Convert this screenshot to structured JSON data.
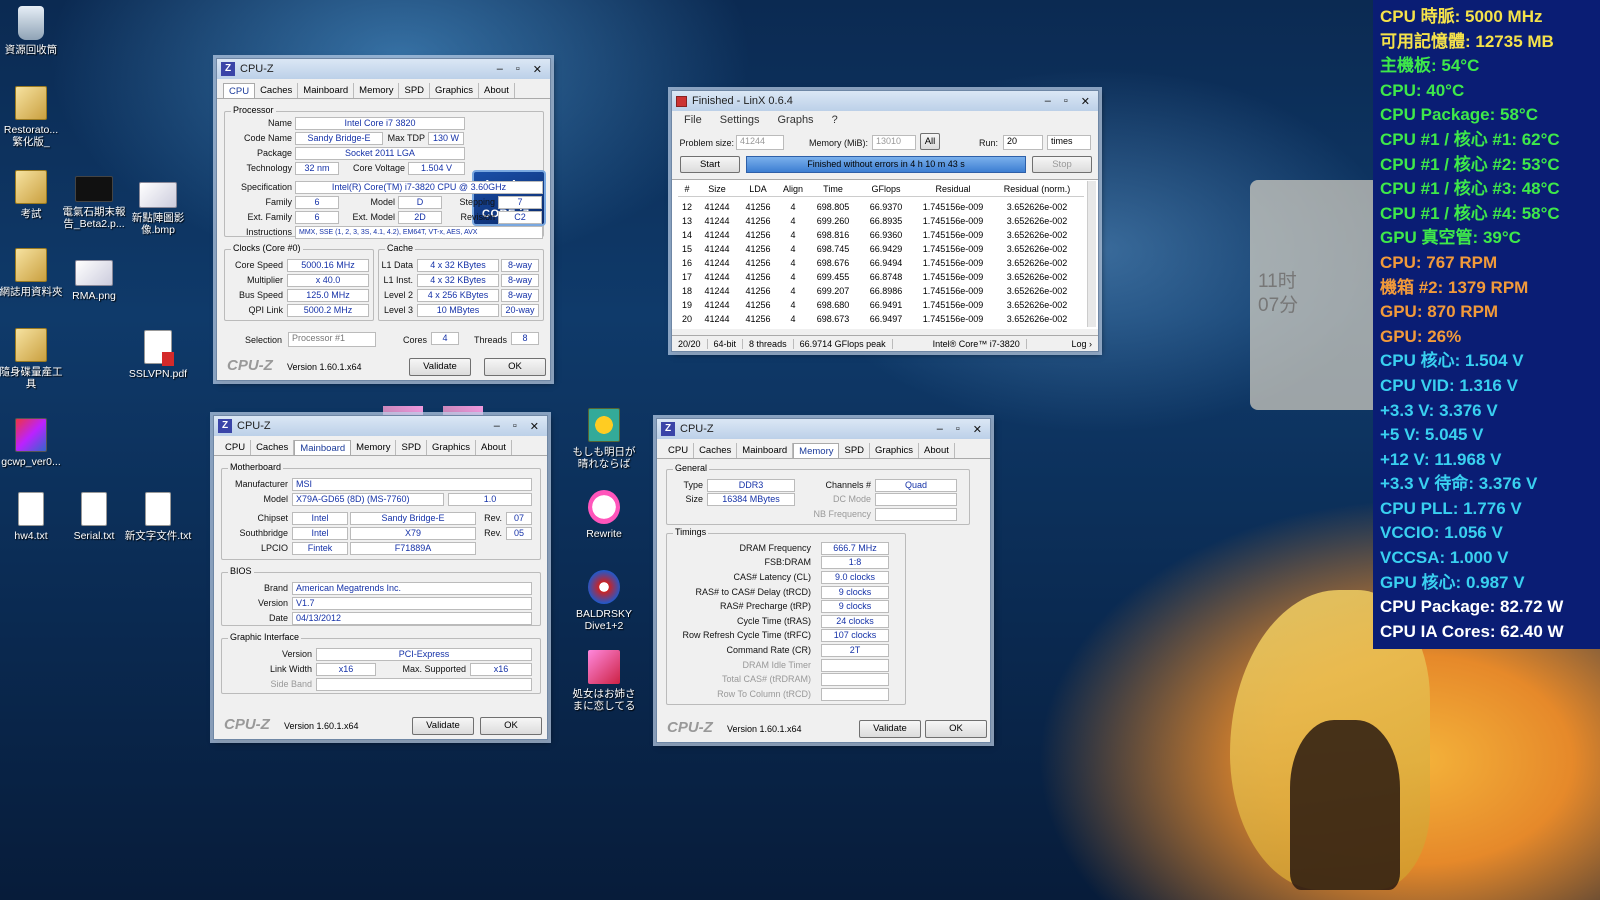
{
  "desktop_icons": [
    {
      "label": "資源回收筒",
      "icon": "recycle-bin-icon"
    },
    {
      "label": "Restorato...\n繁化版_",
      "icon": "folder-icon"
    },
    {
      "label": "考試",
      "icon": "folder-icon"
    },
    {
      "label": "網誌用資料夾",
      "icon": "folder-icon"
    },
    {
      "label": "隨身碟量產工具",
      "icon": "folder-icon"
    },
    {
      "label": "gcwp_ver0...",
      "icon": "app-icon"
    },
    {
      "label": "hw4.txt",
      "icon": "text-file-icon"
    },
    {
      "label": "電氣石期末報告_Beta2.p...",
      "icon": "pptx-icon"
    },
    {
      "label": "RMA.png",
      "icon": "image-icon"
    },
    {
      "label": "Serial.txt",
      "icon": "text-file-icon"
    },
    {
      "label": "新點陣圖影像.bmp",
      "icon": "image-icon"
    },
    {
      "label": "SSLVPN.pdf",
      "icon": "pdf-icon"
    },
    {
      "label": "新文字文件.txt",
      "icon": "text-file-icon"
    },
    {
      "label": "もしも明日が晴れならば",
      "icon": "sunflower-icon"
    },
    {
      "label": "Rewrite",
      "icon": "rewrite-icon"
    },
    {
      "label": "BALDRSKY Dive1+2",
      "icon": "baldrsky-icon"
    },
    {
      "label": "処女はお姉さまに恋してる",
      "icon": "ribbon-icon"
    }
  ],
  "clock_widget": {
    "hour": "11时",
    "minute": "07分"
  },
  "cpuz_cpu": {
    "title": "CPU-Z",
    "tabs": [
      "CPU",
      "Caches",
      "Mainboard",
      "Memory",
      "SPD",
      "Graphics",
      "About"
    ],
    "active_tab": "CPU",
    "processor_group": "Processor",
    "name_label": "Name",
    "name": "Intel Core i7 3820",
    "codename_label": "Code Name",
    "codename": "Sandy Bridge-E",
    "tdp_label": "Max TDP",
    "tdp": "130 W",
    "package_label": "Package",
    "package": "Socket 2011 LGA",
    "technology_label": "Technology",
    "technology": "32 nm",
    "core_voltage_label": "Core Voltage",
    "core_voltage": "1.504 V",
    "spec_label": "Specification",
    "spec": "Intel(R) Core(TM) i7-3820 CPU @ 3.60GHz",
    "family_label": "Family",
    "family": "6",
    "model_label": "Model",
    "model": "D",
    "stepping_label": "Stepping",
    "stepping": "7",
    "ext_family_label": "Ext. Family",
    "ext_family": "6",
    "ext_model_label": "Ext. Model",
    "ext_model": "2D",
    "revision_label": "Revision",
    "revision": "C2",
    "instructions_label": "Instructions",
    "instructions": "MMX, SSE (1, 2, 3, 3S, 4.1, 4.2), EM64T, VT-x, AES, AVX",
    "clocks_group": "Clocks (Core #0)",
    "core_speed_label": "Core Speed",
    "core_speed": "5000.16 MHz",
    "multiplier_label": "Multiplier",
    "multiplier": "x 40.0",
    "bus_speed_label": "Bus Speed",
    "bus_speed": "125.0 MHz",
    "qpi_label": "QPI Link",
    "qpi": "5000.2 MHz",
    "cache_group": "Cache",
    "l1d_label": "L1 Data",
    "l1d": "4 x 32 KBytes",
    "l1d_way": "8-way",
    "l1i_label": "L1 Inst.",
    "l1i": "4 x 32 KBytes",
    "l1i_way": "8-way",
    "l2_label": "Level 2",
    "l2": "4 x 256 KBytes",
    "l2_way": "8-way",
    "l3_label": "Level 3",
    "l3": "10 MBytes",
    "l3_way": "20-way",
    "selection_label": "Selection",
    "selection": "Processor #1",
    "cores_label": "Cores",
    "cores": "4",
    "threads_label": "Threads",
    "threads": "8",
    "logo": "CPU-Z",
    "version": "Version 1.60.1.x64",
    "validate": "Validate",
    "ok": "OK",
    "intel_logo": {
      "brand": "intel",
      "inside": "inside",
      "product": "CORE i7"
    }
  },
  "linx": {
    "title": "Finished - LinX 0.6.4",
    "menu": [
      "File",
      "Settings",
      "Graphs",
      "?"
    ],
    "problem_size_label": "Problem size:",
    "problem_size": "41244",
    "memory_label": "Memory (MiB):",
    "memory": "13010",
    "all_button": "All",
    "run_label": "Run:",
    "run": "20",
    "run_unit": "times",
    "start": "Start",
    "stop": "Stop",
    "status": "Finished without errors in 4 h 10 m 43 s",
    "columns": [
      "#",
      "Size",
      "LDA",
      "Align",
      "Time",
      "GFlops",
      "Residual",
      "Residual (norm.)"
    ],
    "rows": [
      [
        "12",
        "41244",
        "41256",
        "4",
        "698.805",
        "66.9370",
        "1.745156e-009",
        "3.652626e-002"
      ],
      [
        "13",
        "41244",
        "41256",
        "4",
        "699.260",
        "66.8935",
        "1.745156e-009",
        "3.652626e-002"
      ],
      [
        "14",
        "41244",
        "41256",
        "4",
        "698.816",
        "66.9360",
        "1.745156e-009",
        "3.652626e-002"
      ],
      [
        "15",
        "41244",
        "41256",
        "4",
        "698.745",
        "66.9429",
        "1.745156e-009",
        "3.652626e-002"
      ],
      [
        "16",
        "41244",
        "41256",
        "4",
        "698.676",
        "66.9494",
        "1.745156e-009",
        "3.652626e-002"
      ],
      [
        "17",
        "41244",
        "41256",
        "4",
        "699.455",
        "66.8748",
        "1.745156e-009",
        "3.652626e-002"
      ],
      [
        "18",
        "41244",
        "41256",
        "4",
        "699.207",
        "66.8986",
        "1.745156e-009",
        "3.652626e-002"
      ],
      [
        "19",
        "41244",
        "41256",
        "4",
        "698.680",
        "66.9491",
        "1.745156e-009",
        "3.652626e-002"
      ],
      [
        "20",
        "41244",
        "41256",
        "4",
        "698.673",
        "66.9497",
        "1.745156e-009",
        "3.652626e-002"
      ]
    ],
    "statusbar": [
      "20/20",
      "64-bit",
      "8 threads",
      "66.9714 GFlops peak",
      "Intel® Core™ i7-3820",
      "Log ›"
    ]
  },
  "cpuz_mb": {
    "title": "CPU-Z",
    "tabs": [
      "CPU",
      "Caches",
      "Mainboard",
      "Memory",
      "SPD",
      "Graphics",
      "About"
    ],
    "active_tab": "Mainboard",
    "motherboard_group": "Motherboard",
    "manufacturer_label": "Manufacturer",
    "manufacturer": "MSI",
    "model_label": "Model",
    "model": "X79A-GD65 (8D) (MS-7760)",
    "model_rev": "1.0",
    "chipset_label": "Chipset",
    "chipset_vendor": "Intel",
    "chipset": "Sandy Bridge-E",
    "chipset_rev_label": "Rev.",
    "chipset_rev": "07",
    "southbridge_label": "Southbridge",
    "sb_vendor": "Intel",
    "sb": "X79",
    "sb_rev_label": "Rev.",
    "sb_rev": "05",
    "lpcio_label": "LPCIO",
    "lpcio_vendor": "Fintek",
    "lpcio": "F71889A",
    "bios_group": "BIOS",
    "brand_label": "Brand",
    "brand": "American Megatrends Inc.",
    "version_label": "Version",
    "bios_version": "V1.7",
    "date_label": "Date",
    "date": "04/13/2012",
    "graphic_group": "Graphic Interface",
    "gi_version_label": "Version",
    "gi_version": "PCI-Express",
    "link_width_label": "Link Width",
    "link_width": "x16",
    "max_supported_label": "Max. Supported",
    "max_supported": "x16",
    "side_band_label": "Side Band",
    "logo": "CPU-Z",
    "version": "Version 1.60.1.x64",
    "validate": "Validate",
    "ok": "OK"
  },
  "cpuz_mem": {
    "title": "CPU-Z",
    "tabs": [
      "CPU",
      "Caches",
      "Mainboard",
      "Memory",
      "SPD",
      "Graphics",
      "About"
    ],
    "active_tab": "Memory",
    "general_group": "General",
    "type_label": "Type",
    "type": "DDR3",
    "channels_label": "Channels #",
    "channels": "Quad",
    "size_label": "Size",
    "size": "16384 MBytes",
    "dc_mode_label": "DC Mode",
    "nb_freq_label": "NB Frequency",
    "timings_group": "Timings",
    "dram_freq_label": "DRAM Frequency",
    "dram_freq": "666.7 MHz",
    "fsb_dram_label": "FSB:DRAM",
    "fsb_dram": "1:8",
    "cl_label": "CAS# Latency (CL)",
    "cl": "9.0 clocks",
    "trcd_label": "RAS# to CAS# Delay (tRCD)",
    "trcd": "9 clocks",
    "trp_label": "RAS# Precharge (tRP)",
    "trp": "9 clocks",
    "tras_label": "Cycle Time (tRAS)",
    "tras": "24 clocks",
    "trfc_label": "Row Refresh Cycle Time (tRFC)",
    "trfc": "107 clocks",
    "cr_label": "Command Rate (CR)",
    "cr": "2T",
    "idle_label": "DRAM Idle Timer",
    "total_cas_label": "Total CAS# (tRDRAM)",
    "row_col_label": "Row To Column (tRCD)",
    "logo": "CPU-Z",
    "version": "Version 1.60.1.x64",
    "validate": "Validate",
    "ok": "OK"
  },
  "sensors": [
    {
      "text": "CPU 時脈: 5000 MHz",
      "color": "#f5e24a"
    },
    {
      "text": "可用記憶體: 12735 MB",
      "color": "#f5e24a"
    },
    {
      "text": "主機板: 54°C",
      "color": "#3ee84a"
    },
    {
      "text": "CPU: 40°C",
      "color": "#3ee84a"
    },
    {
      "text": "CPU Package: 58°C",
      "color": "#3ee84a"
    },
    {
      "text": "CPU #1 / 核心 #1: 62°C",
      "color": "#3ee84a"
    },
    {
      "text": "CPU #1 / 核心 #2: 53°C",
      "color": "#3ee84a"
    },
    {
      "text": "CPU #1 / 核心 #3: 48°C",
      "color": "#3ee84a"
    },
    {
      "text": "CPU #1 / 核心 #4: 58°C",
      "color": "#3ee84a"
    },
    {
      "text": "GPU 真空管: 39°C",
      "color": "#3ee84a"
    },
    {
      "text": "CPU: 767 RPM",
      "color": "#f29a3a"
    },
    {
      "text": "機箱 #2: 1379 RPM",
      "color": "#f29a3a"
    },
    {
      "text": "GPU: 870 RPM",
      "color": "#f29a3a"
    },
    {
      "text": "GPU: 26%",
      "color": "#f29a3a"
    },
    {
      "text": "CPU 核心: 1.504 V",
      "color": "#39d0f0"
    },
    {
      "text": "CPU VID: 1.316 V",
      "color": "#39d0f0"
    },
    {
      "text": "+3.3 V: 3.376 V",
      "color": "#39d0f0"
    },
    {
      "text": "+5 V: 5.045 V",
      "color": "#39d0f0"
    },
    {
      "text": "+12 V: 11.968 V",
      "color": "#39d0f0"
    },
    {
      "text": "+3.3 V 待命: 3.376 V",
      "color": "#39d0f0"
    },
    {
      "text": "CPU PLL: 1.776 V",
      "color": "#39d0f0"
    },
    {
      "text": "VCCIO: 1.056 V",
      "color": "#39d0f0"
    },
    {
      "text": "VCCSA: 1.000 V",
      "color": "#39d0f0"
    },
    {
      "text": "GPU 核心: 0.987 V",
      "color": "#39d0f0"
    },
    {
      "text": "CPU Package: 82.72 W",
      "color": "#ffffff"
    },
    {
      "text": "CPU IA Cores: 62.40 W",
      "color": "#ffffff"
    }
  ]
}
